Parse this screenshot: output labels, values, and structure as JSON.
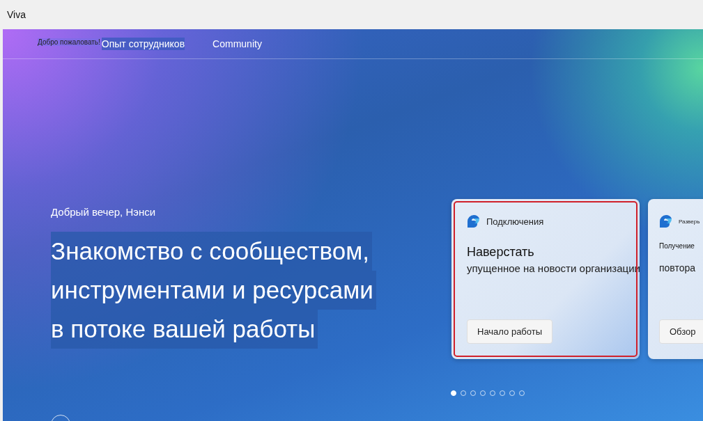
{
  "window": {
    "title": "Viva"
  },
  "nav": {
    "welcome": "Добро пожаловать!",
    "links": [
      {
        "label": "Опыт сотрудников",
        "selected": true
      },
      {
        "label": "Community",
        "selected": false
      }
    ]
  },
  "hero": {
    "greeting": "Добрый вечер, Нэнси",
    "headline": [
      "Знакомство с сообществом,",
      "инструментами и ресурсами",
      "в потоке вашей работы"
    ]
  },
  "cards": [
    {
      "app": "Подключения",
      "title": "Наверстать",
      "subtitle": "упущенное на новости организации",
      "button": "Начало работы",
      "selected": true
    },
    {
      "app": "Разверь",
      "title": "Получение",
      "subtitle": "повтора",
      "button": "Обзор",
      "selected": false
    }
  ],
  "dots": [
    {
      "selected": true
    },
    {
      "selected": false
    },
    {
      "selected": false
    },
    {
      "selected": false
    },
    {
      "selected": false
    },
    {
      "selected": false
    },
    {
      "selected": false
    },
    {
      "selected": false
    }
  ]
}
